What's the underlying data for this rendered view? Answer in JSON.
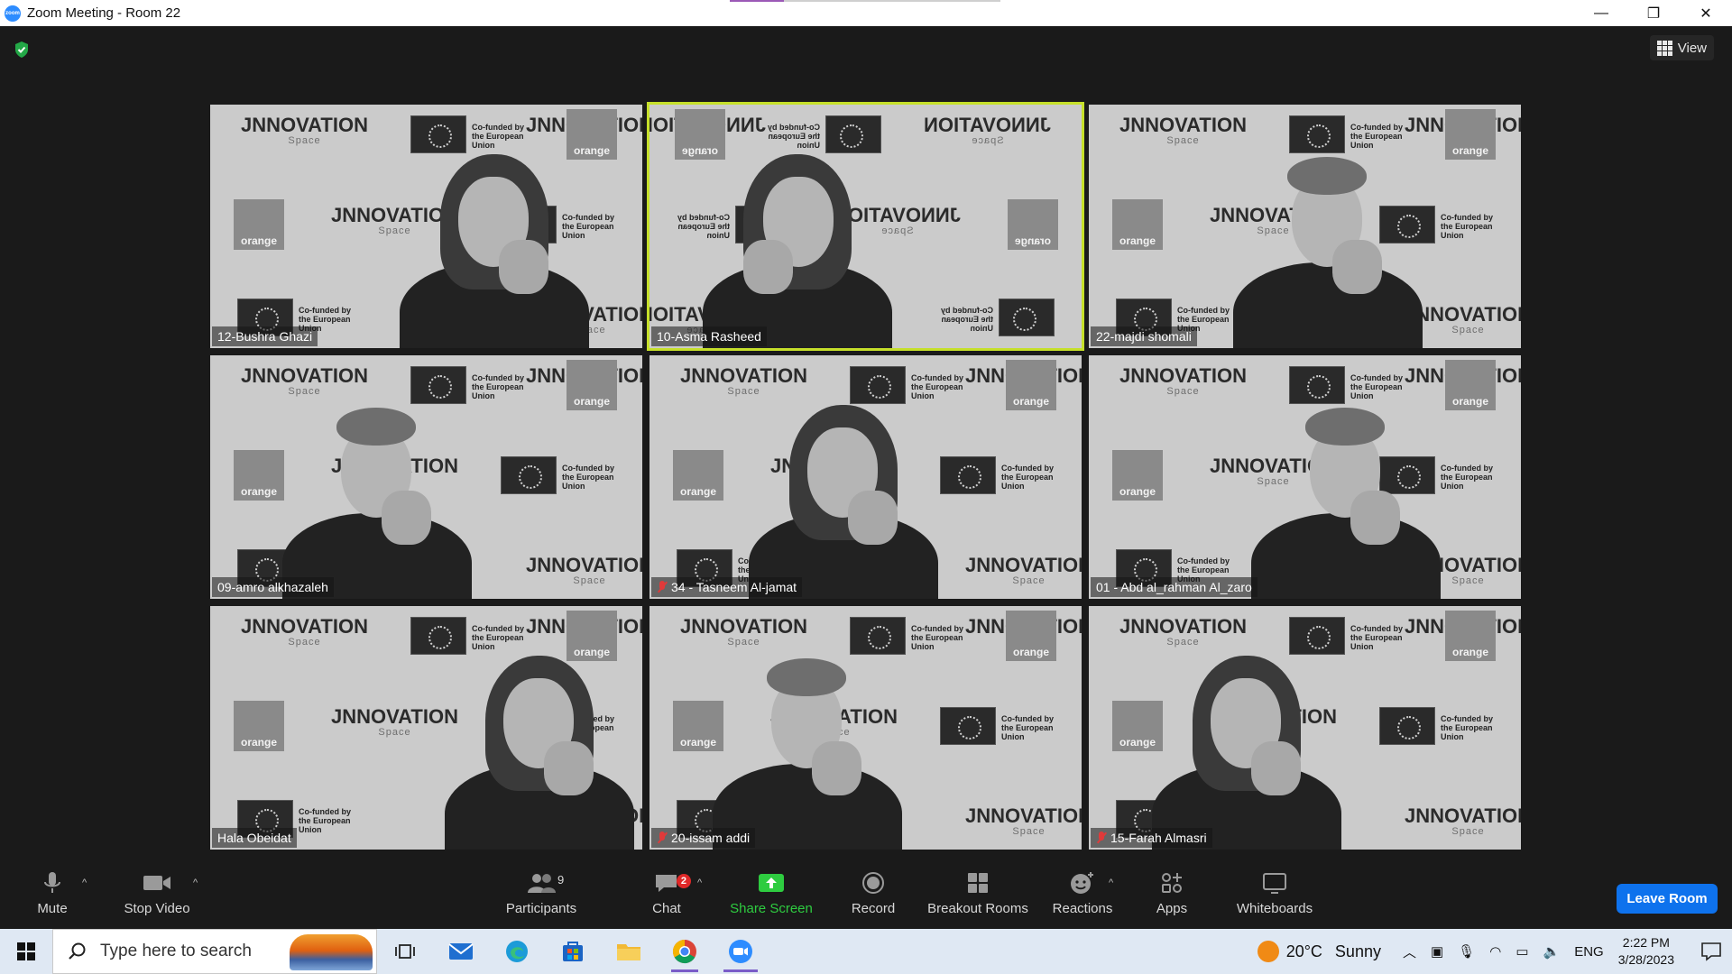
{
  "window": {
    "title": "Zoom Meeting - Room 22",
    "controls": {
      "minimize": "—",
      "restore": "❐",
      "close": "✕"
    }
  },
  "meeting": {
    "view_label": "View",
    "encryption_icon": "shield-check-icon",
    "colors": {
      "active_speaker": "#c6e02a",
      "leave": "#0e72ed",
      "share": "#2ecc40",
      "badge": "#e02828"
    },
    "participants": [
      {
        "name": "12-Bushra Ghazi",
        "muted": false,
        "active": false,
        "mirrored": false
      },
      {
        "name": "10-Asma Rasheed",
        "muted": false,
        "active": true,
        "mirrored": true
      },
      {
        "name": "22-majdi shomali",
        "muted": false,
        "active": false,
        "mirrored": false
      },
      {
        "name": "09-amro alkhazaleh",
        "muted": false,
        "active": false,
        "mirrored": false
      },
      {
        "name": "34 - Tasneem Al-jamat",
        "muted": true,
        "active": false,
        "mirrored": false
      },
      {
        "name": "01 - Abd al_rahman Al_zaro",
        "muted": false,
        "active": false,
        "mirrored": false
      },
      {
        "name": "Hala Obeidat",
        "muted": false,
        "active": false,
        "mirrored": false
      },
      {
        "name": "20-issam addi",
        "muted": true,
        "active": false,
        "mirrored": false
      },
      {
        "name": "15-Farah Almasri",
        "muted": true,
        "active": false,
        "mirrored": false
      }
    ],
    "backdrop": {
      "brand": "JNNOVATION",
      "brand_sub": "Space",
      "orange": "orange",
      "eu_text": "Co-funded by the European Union"
    }
  },
  "toolbar": {
    "mute": "Mute",
    "stop_video": "Stop Video",
    "participants": "Participants",
    "participants_count": "9",
    "chat": "Chat",
    "chat_badge": "2",
    "share_screen": "Share Screen",
    "record": "Record",
    "breakout_rooms": "Breakout Rooms",
    "reactions": "Reactions",
    "apps": "Apps",
    "whiteboards": "Whiteboards",
    "leave_room": "Leave Room"
  },
  "taskbar": {
    "search_placeholder": "Type here to search",
    "weather": {
      "temp": "20°C",
      "condition": "Sunny"
    },
    "language": "ENG",
    "time": "2:22 PM",
    "date": "3/28/2023"
  }
}
